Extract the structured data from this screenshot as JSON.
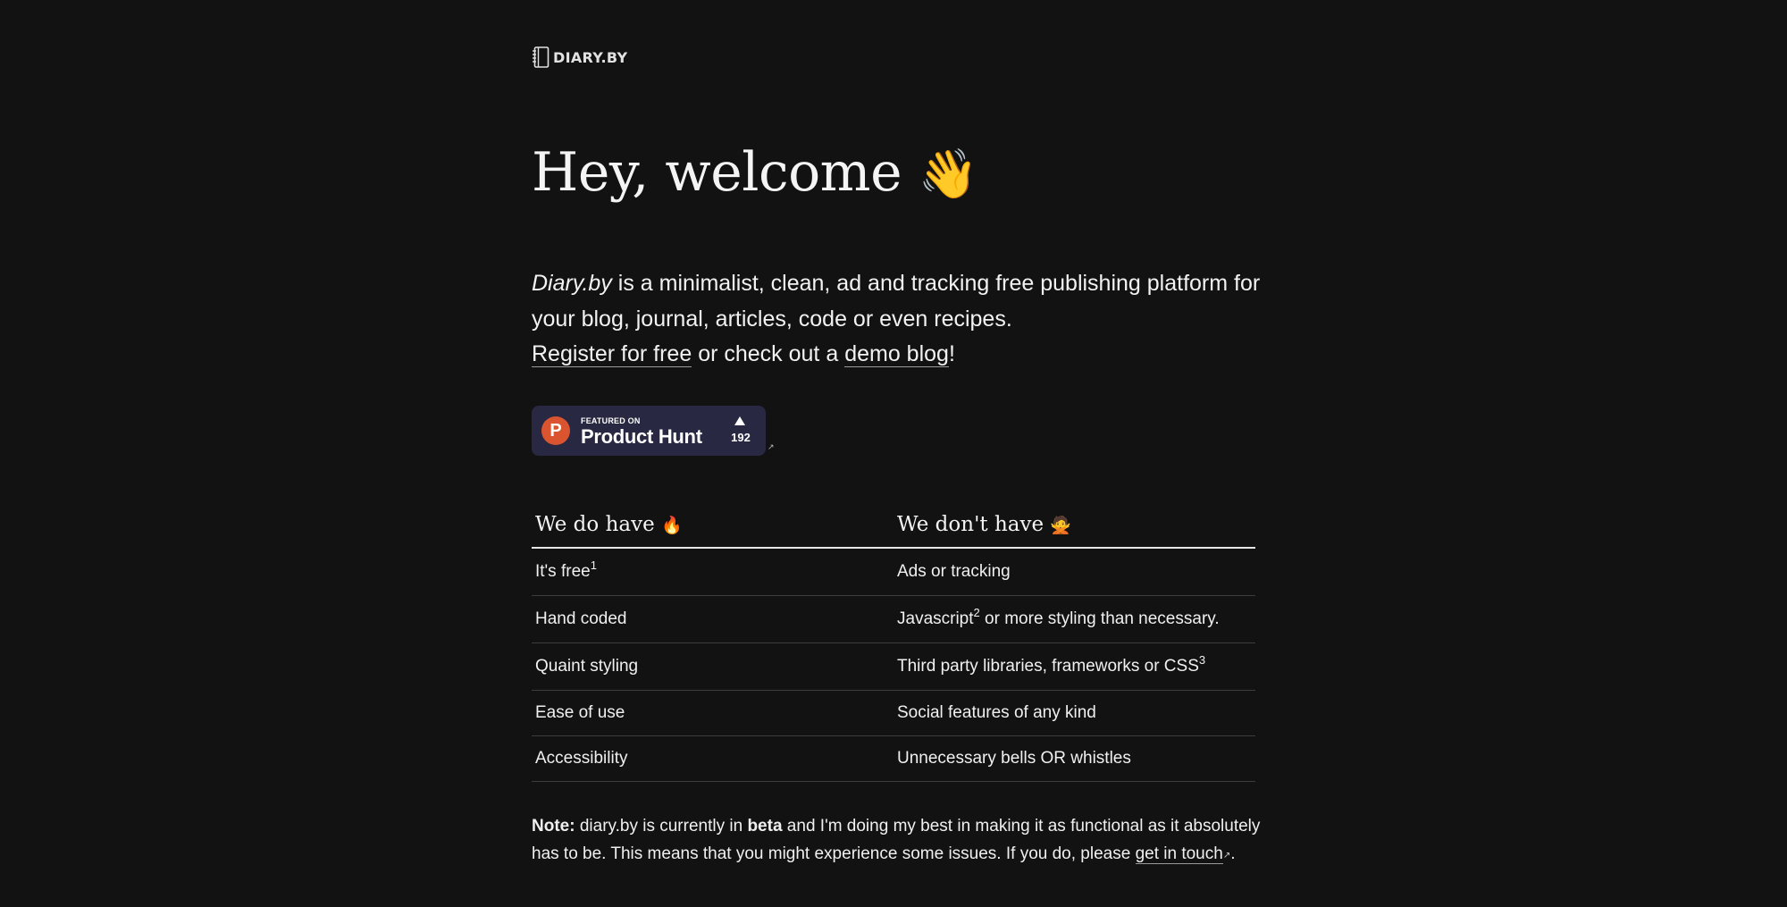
{
  "logo": {
    "text": "DIARY.BY",
    "icon": "notebook-icon"
  },
  "hero": {
    "title": "Hey, welcome",
    "emoji": "👋"
  },
  "intro": {
    "brand": "Diary.by",
    "line1_rest": " is a minimalist, clean, ad and tracking free publishing platform for your blog, journal, articles, code or even recipes.",
    "register_link": "Register for free",
    "middle": " or check out a ",
    "demo_link": "demo blog",
    "end": "!"
  },
  "product_hunt": {
    "featured": "FEATURED ON",
    "name": "Product Hunt",
    "logo_letter": "P",
    "upvotes": "192",
    "external_mark": "↗"
  },
  "features": {
    "have_header": "We do have",
    "have_emoji": "🔥",
    "dont_header": "We don't have",
    "dont_emoji": "🙅",
    "rows": [
      {
        "have": "It's free",
        "have_sup": "1",
        "dont": "Ads or tracking",
        "dont_sup": "",
        "dont_after": ""
      },
      {
        "have": "Hand coded",
        "have_sup": "",
        "dont": "Javascript",
        "dont_sup": "2",
        "dont_after": " or more styling than necessary."
      },
      {
        "have": "Quaint styling",
        "have_sup": "",
        "dont": "Third party libraries, frameworks or CSS",
        "dont_sup": "3",
        "dont_after": ""
      },
      {
        "have": "Ease of use",
        "have_sup": "",
        "dont": "Social features of any kind",
        "dont_sup": "",
        "dont_after": ""
      },
      {
        "have": "Accessibility",
        "have_sup": "",
        "dont": "Unnecessary bells OR whistles",
        "dont_sup": "",
        "dont_after": ""
      }
    ]
  },
  "note": {
    "label": "Note:",
    "part1": " diary.by is currently in ",
    "beta": "beta",
    "part2": " and I'm doing my best in making it as functional as it absolutely has to be. This means that you might experience some issues. If you do, please ",
    "link": "get in touch",
    "ext": "↗",
    "end": "."
  },
  "colors": {
    "background": "#121212",
    "text": "#f2f2f2",
    "ph_badge": "#282843",
    "ph_orange": "#da552f"
  }
}
